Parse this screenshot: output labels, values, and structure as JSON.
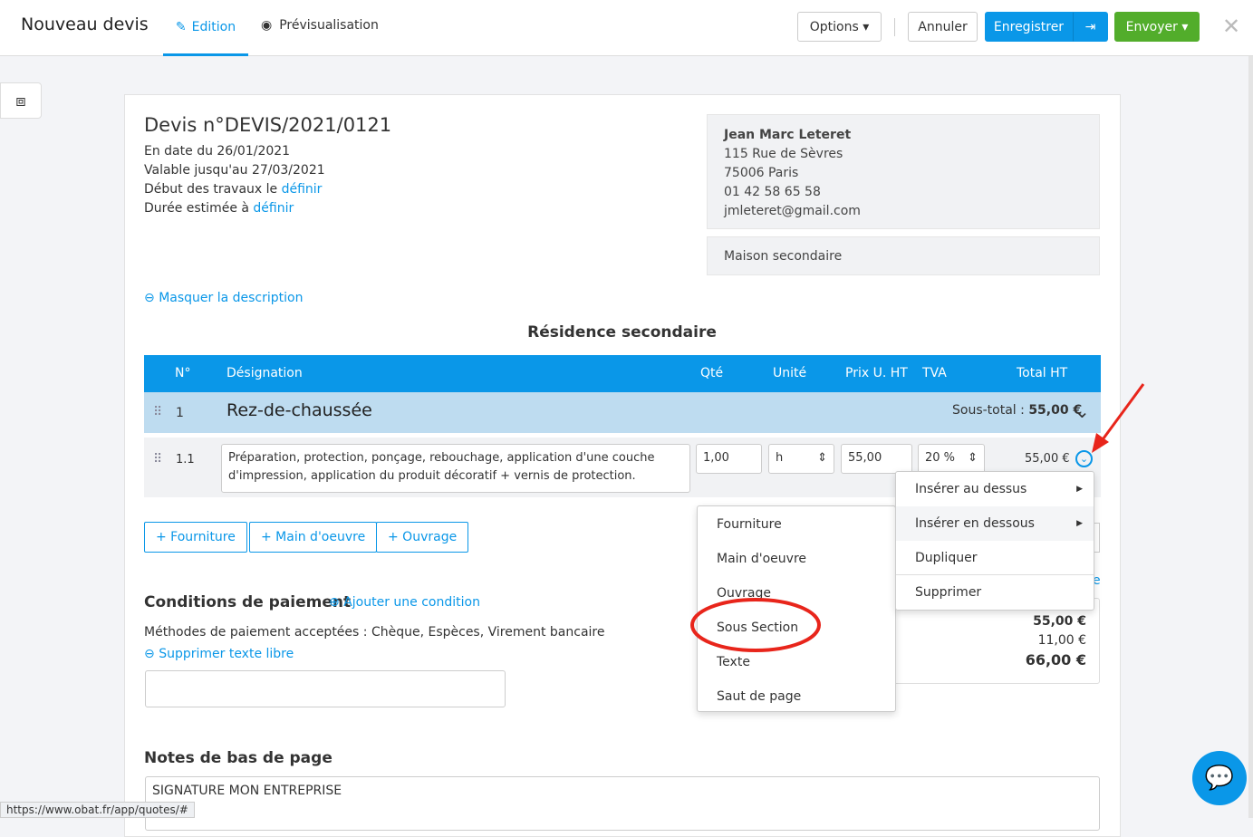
{
  "header": {
    "title": "Nouveau devis",
    "tabs": [
      {
        "label": "Edition",
        "active": true
      },
      {
        "label": "Prévisualisation"
      }
    ],
    "options": "Options",
    "cancel": "Annuler",
    "save": "Enregistrer",
    "send": "Envoyer"
  },
  "colors": {
    "accent": "#0a97e8",
    "send": "#52ad2b",
    "section_row": "#bedcf0"
  },
  "quote": {
    "number": "Devis n°DEVIS/2021/0121",
    "date": "En date du 26/01/2021",
    "valid": "Valable jusqu'au 27/03/2021",
    "start_label": "Début des travaux le",
    "start_link": "définir",
    "duration_label": "Durée estimée à",
    "duration_link": "définir"
  },
  "client": {
    "name": "Jean Marc Leteret",
    "street": "115 Rue de Sèvres",
    "city": "75006 Paris",
    "phone": "01 42 58 65 58",
    "email": "jmleteret@gmail.com",
    "site": "Maison secondaire"
  },
  "hide_description": "Masquer la description",
  "project_title": "Résidence secondaire",
  "table": {
    "headers": [
      "N°",
      "Désignation",
      "Qté",
      "Unité",
      "Prix U. HT",
      "TVA",
      "Total HT"
    ],
    "section": {
      "num": "1",
      "title": "Rez-de-chaussée",
      "subtotal_label": "Sous-total :",
      "subtotal": "55,00 €"
    },
    "line": {
      "num": "1.1",
      "designation_1": "Préparation, protection, ponçage, rebouchage, application d'une couche",
      "designation_2": "d'impression, application du produit décoratif + vernis de protection.",
      "qty": "1,00",
      "unit": "h",
      "price": "55,00",
      "tva": "20 %",
      "total": "55,00 €"
    }
  },
  "add_buttons": [
    "+ Fourniture",
    "+ Main d'oeuvre",
    "+ Ouvrage"
  ],
  "payment": {
    "title": "Conditions de paiement",
    "add": "Ajouter une condition",
    "methods": "Méthodes de paiement acceptées : Chèque, Espèces, Virement bancaire",
    "remove_free_text": "Supprimer texte libre"
  },
  "totals": {
    "ht": "55,00 €",
    "tva": "11,00 €",
    "ttc": "66,00 €",
    "partial_link": "e"
  },
  "footer": {
    "title": "Notes de bas de page",
    "text": "SIGNATURE MON ENTREPRISE"
  },
  "submenu": [
    "Fourniture",
    "Main d'oeuvre",
    "Ouvrage",
    "Sous Section",
    "Texte",
    "Saut de page"
  ],
  "context_menu": [
    "Insérer au dessus",
    "Insérer en dessous",
    "Dupliquer",
    "Supprimer"
  ],
  "status_url": "https://www.obat.fr/app/quotes/#"
}
